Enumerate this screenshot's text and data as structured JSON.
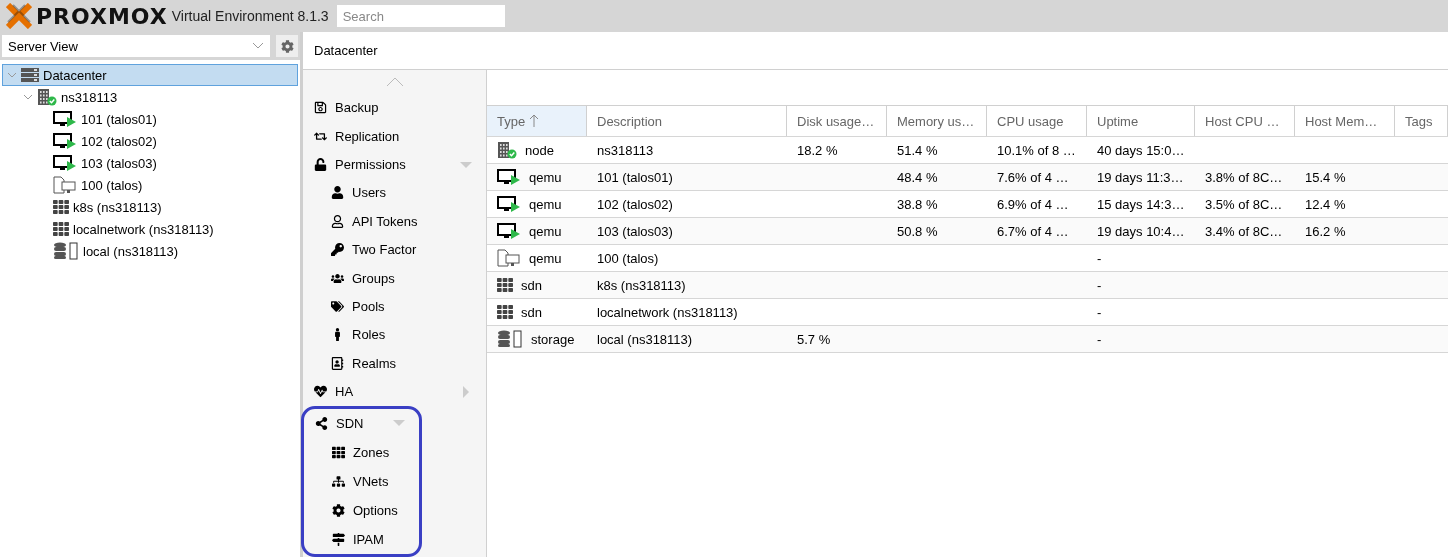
{
  "header": {
    "brand": "PROXMOX",
    "product": "Virtual Environment 8.1.3",
    "search": {
      "placeholder": "Search"
    }
  },
  "sidebar": {
    "view_select": "Server View",
    "tree": [
      {
        "label": "Datacenter",
        "kind": "datacenter",
        "selected": true,
        "expanded": true,
        "children": [
          {
            "label": "ns318113",
            "kind": "node",
            "online": true,
            "selected": false,
            "expanded": true,
            "children": [
              {
                "label": "101 (talos01)",
                "kind": "vm",
                "running": true,
                "selected": false
              },
              {
                "label": "102 (talos02)",
                "kind": "vm",
                "running": true,
                "selected": false
              },
              {
                "label": "103 (talos03)",
                "kind": "vm",
                "running": true,
                "selected": false
              },
              {
                "label": "100 (talos)",
                "kind": "vm",
                "running": false,
                "selected": false
              },
              {
                "label": "k8s (ns318113)",
                "kind": "sdn",
                "selected": false
              },
              {
                "label": "localnetwork (ns318113)",
                "kind": "sdn",
                "selected": false
              },
              {
                "label": "local (ns318113)",
                "kind": "storage",
                "selected": false
              }
            ]
          }
        ]
      }
    ]
  },
  "panel_title": "Datacenter",
  "nav": [
    {
      "label": "Backup",
      "kind": "item",
      "selected": false
    },
    {
      "label": "Replication",
      "kind": "item",
      "selected": false
    },
    {
      "label": "Permissions",
      "kind": "group",
      "expanded": true,
      "selected": false,
      "children": [
        {
          "label": "Users",
          "selected": false
        },
        {
          "label": "API Tokens",
          "selected": false
        },
        {
          "label": "Two Factor",
          "selected": false
        },
        {
          "label": "Groups",
          "selected": false
        },
        {
          "label": "Pools",
          "selected": false
        },
        {
          "label": "Roles",
          "selected": false
        },
        {
          "label": "Realms",
          "selected": false
        }
      ]
    },
    {
      "label": "HA",
      "kind": "group",
      "expanded": false,
      "selected": false
    },
    {
      "label": "SDN",
      "kind": "group",
      "expanded": true,
      "selected": false,
      "highlighted": true,
      "children": [
        {
          "label": "Zones",
          "selected": false
        },
        {
          "label": "VNets",
          "selected": false
        },
        {
          "label": "Options",
          "selected": false
        },
        {
          "label": "IPAM",
          "selected": false
        }
      ]
    }
  ],
  "table": {
    "columns": [
      {
        "label": "Type",
        "sorted": true
      },
      {
        "label": "Description",
        "sorted": false
      },
      {
        "label": "Disk usage…",
        "sorted": false
      },
      {
        "label": "Memory us…",
        "sorted": false
      },
      {
        "label": "CPU usage",
        "sorted": false
      },
      {
        "label": "Uptime",
        "sorted": false
      },
      {
        "label": "Host CPU …",
        "sorted": false
      },
      {
        "label": "Host Mem…",
        "sorted": false
      },
      {
        "label": "Tags",
        "sorted": false
      }
    ],
    "rows": [
      {
        "kind": "node",
        "online": true,
        "cells": [
          "node",
          "ns318113",
          "18.2 %",
          "51.4 %",
          "10.1% of 8 …",
          "40 days 15:0…",
          "",
          "",
          ""
        ]
      },
      {
        "kind": "vm",
        "running": true,
        "cells": [
          "qemu",
          "101 (talos01)",
          "",
          "48.4 %",
          "7.6% of 4 …",
          "19 days 11:3…",
          "3.8% of 8C…",
          "15.4 %",
          ""
        ]
      },
      {
        "kind": "vm",
        "running": true,
        "cells": [
          "qemu",
          "102 (talos02)",
          "",
          "38.8 %",
          "6.9% of 4 …",
          "15 days 14:3…",
          "3.5% of 8C…",
          "12.4 %",
          ""
        ]
      },
      {
        "kind": "vm",
        "running": true,
        "cells": [
          "qemu",
          "103 (talos03)",
          "",
          "50.8 %",
          "6.7% of 4 …",
          "19 days 10:4…",
          "3.4% of 8C…",
          "16.2 %",
          ""
        ]
      },
      {
        "kind": "vm",
        "running": false,
        "cells": [
          "qemu",
          "100 (talos)",
          "",
          "",
          "",
          "-",
          "",
          "",
          ""
        ]
      },
      {
        "kind": "sdn",
        "cells": [
          "sdn",
          "k8s (ns318113)",
          "",
          "",
          "",
          "-",
          "",
          "",
          ""
        ]
      },
      {
        "kind": "sdn",
        "cells": [
          "sdn",
          "localnetwork (ns318113)",
          "",
          "",
          "",
          "-",
          "",
          "",
          ""
        ]
      },
      {
        "kind": "storage",
        "cells": [
          "storage",
          "local (ns318113)",
          "5.7 %",
          "",
          "",
          "-",
          "",
          "",
          ""
        ]
      }
    ]
  }
}
